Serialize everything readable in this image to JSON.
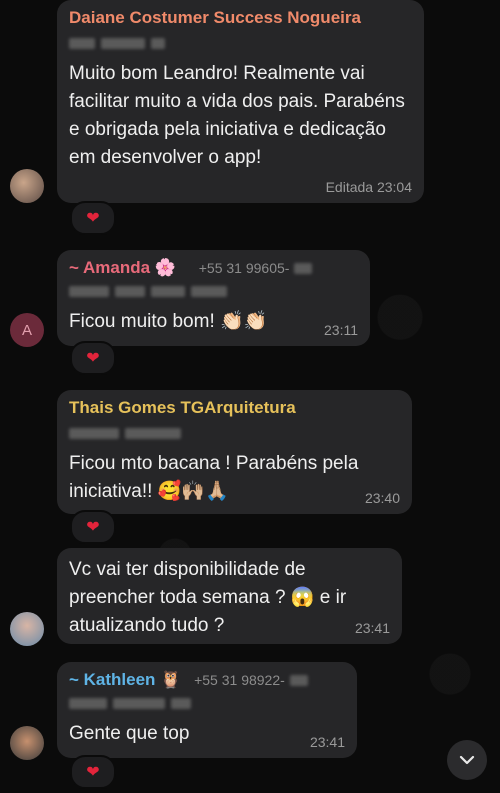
{
  "messages": [
    {
      "sender": "Daiane Costumer Success Nogueira",
      "sender_color": "#f08a6a",
      "text": "Muito bom Leandro! Realmente vai facilitar muito a vida dos pais. Parabéns e obrigada pela iniciativa e dedicação em desenvolver o app!",
      "time": "Editada 23:04",
      "reaction": "❤"
    },
    {
      "sender": "~ Amanda",
      "sender_emoji": "🌸",
      "phone": "+55 31 99605-",
      "sender_color": "#e86a7a",
      "avatar_letter": "A",
      "text": "Ficou muito bom! 👏🏻👏🏻",
      "time": "23:11",
      "reaction": "❤"
    },
    {
      "sender": "Thais Gomes TGArquitetura",
      "sender_color": "#e6c15a",
      "text": "Ficou mto bacana ! Parabéns pela iniciativa!! 🥰🙌🏼🙏🏼",
      "time": "23:40",
      "reaction": "❤"
    },
    {
      "text": "Vc vai ter disponibilidade de preencher toda semana ? 😱 e ir atualizando tudo ?",
      "time": "23:41"
    },
    {
      "sender": "~ Kathleen",
      "sender_emoji": "🦉",
      "phone": "+55 31 98922-",
      "sender_color": "#5fb4e6",
      "text": "Gente que top",
      "time": "23:41",
      "reaction": "❤"
    }
  ],
  "icons": {
    "scroll_down": "chevron-down-icon",
    "heart": "heart-icon"
  }
}
